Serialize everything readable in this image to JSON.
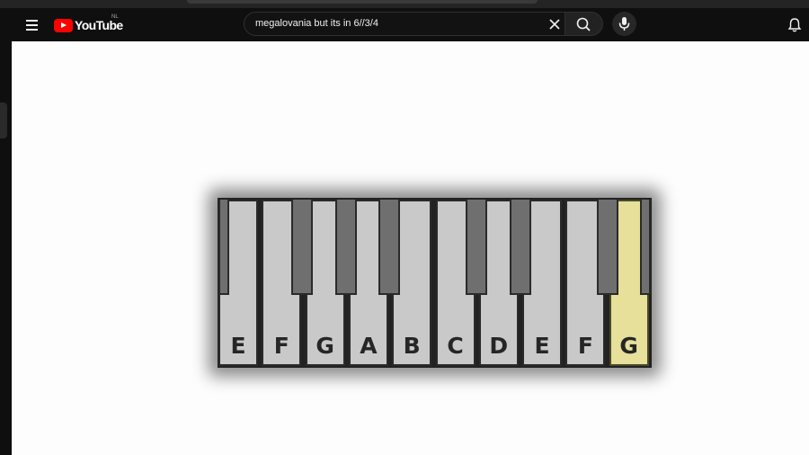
{
  "header": {
    "logo_text": "YouTube",
    "country_code": "NL",
    "search": {
      "value": "megalovania but its in 6//3/4",
      "placeholder": "Search"
    }
  },
  "keyboard": {
    "white_keys": [
      "E",
      "F",
      "G",
      "A",
      "B",
      "C",
      "D",
      "E",
      "F",
      "G"
    ],
    "highlighted_key_index": 9,
    "colors": {
      "white_key": "#c9c9c9",
      "black_key": "#6f6f6f",
      "highlight": "#e6e09a"
    }
  }
}
